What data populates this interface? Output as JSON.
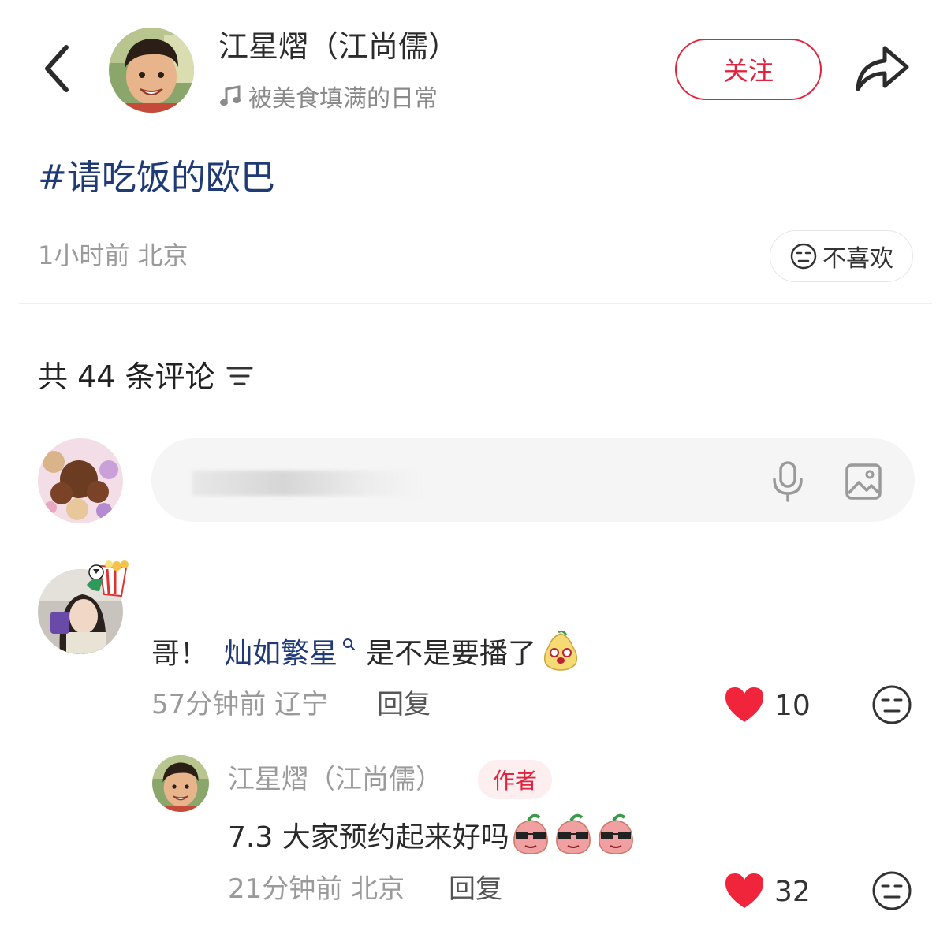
{
  "header": {
    "author_name": "江星熠（江尚儒）",
    "music_title": "被美食填满的日常",
    "follow_label": "关注",
    "icons": {
      "back": "chevron-left-icon",
      "music": "music-note-icon",
      "share": "share-arrow-icon"
    }
  },
  "post": {
    "hashtag": "#请吃饭的欧巴",
    "time": "1小时前",
    "location": "北京",
    "dislike_label": "不喜欢"
  },
  "comments_section": {
    "count_text": "共 44 条评论",
    "input_placeholder": "",
    "icons": {
      "sort": "sort-lines-icon",
      "mic": "microphone-icon",
      "image": "image-icon"
    }
  },
  "comments": [
    {
      "prefix": "哥！",
      "mention": "灿如繁星",
      "text": "是不是要播了",
      "time": "57分钟前",
      "location": "辽宁",
      "reply_label": "回复",
      "likes": "10",
      "replies": [
        {
          "name": "江星熠（江尚儒）",
          "badge": "作者",
          "text": "7.3 大家预约起来好吗",
          "time": "21分钟前",
          "location": "北京",
          "reply_label": "回复",
          "likes": "32"
        }
      ]
    }
  ],
  "colors": {
    "accent_red": "#e0243f",
    "hashtag_blue": "#1f3a74",
    "muted_gray": "#9a9a9a",
    "like_red": "#f0243a"
  }
}
